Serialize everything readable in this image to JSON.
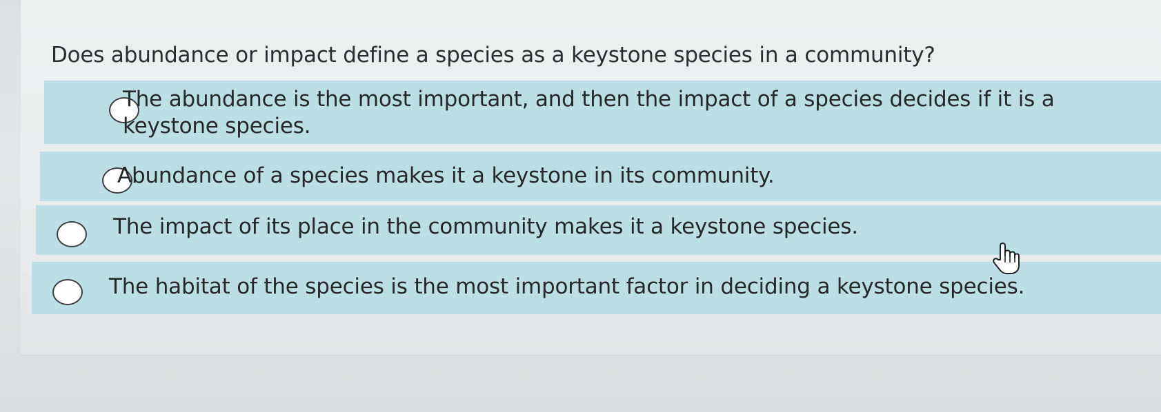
{
  "question": {
    "text": "Does abundance or impact define a species as a keystone species in a community?"
  },
  "options": [
    {
      "label": "The abundance is the most important, and then the impact of a species decides if it is a keystone species.",
      "selected": false
    },
    {
      "label": "Abundance of a species makes it a keystone in its community.",
      "selected": false
    },
    {
      "label": "The impact of its place in the community makes it a keystone species.",
      "selected": false
    },
    {
      "label": "The habitat of the species is the most important factor in deciding a keystone species.",
      "selected": false
    }
  ],
  "colors": {
    "option_background": "#bcdfe6",
    "text": "#25282b",
    "page_background": "#e9ebec"
  },
  "cursor": {
    "icon": "hand-pointer-icon"
  }
}
